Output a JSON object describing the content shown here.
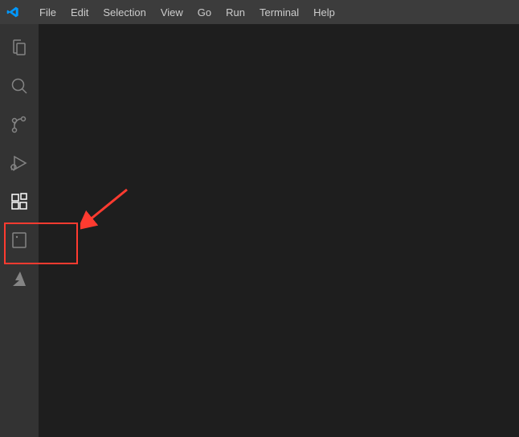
{
  "menu": {
    "items": [
      "File",
      "Edit",
      "Selection",
      "View",
      "Go",
      "Run",
      "Terminal",
      "Help"
    ]
  },
  "activityBar": {
    "items": [
      {
        "name": "explorer-icon"
      },
      {
        "name": "search-icon"
      },
      {
        "name": "source-control-icon"
      },
      {
        "name": "run-debug-icon"
      },
      {
        "name": "extensions-icon"
      },
      {
        "name": "remote-explorer-icon"
      },
      {
        "name": "azure-icon"
      }
    ]
  }
}
